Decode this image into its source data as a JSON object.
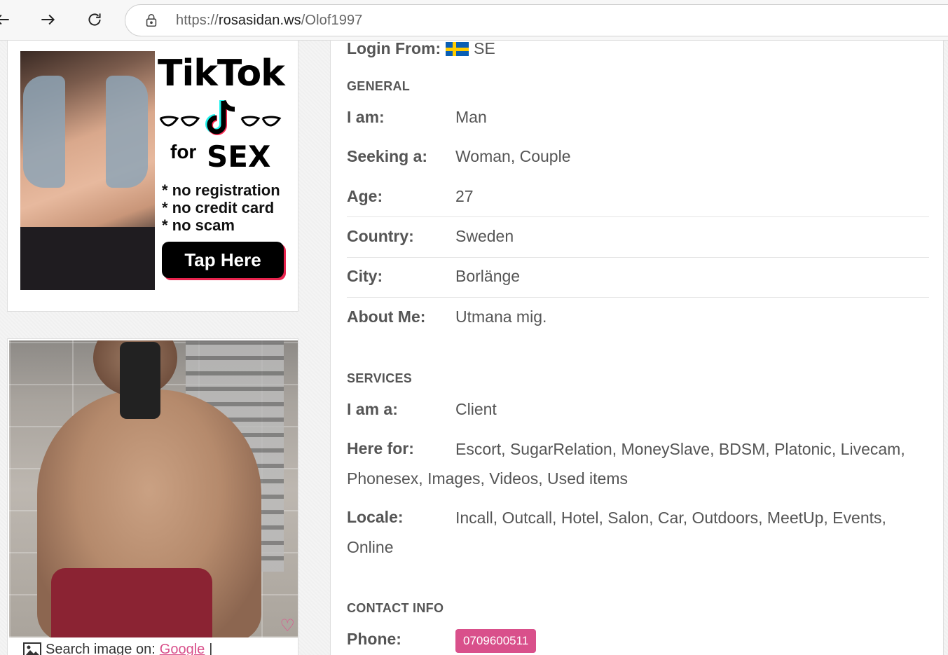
{
  "browser": {
    "url_scheme": "https://",
    "url_host": "rosasidan.ws",
    "url_path": "/Olof1997"
  },
  "ad": {
    "title": "TikTok",
    "for": "for",
    "sex": "SEX",
    "bullet1": "* no registration",
    "bullet2": "* no credit card",
    "bullet3": "* no scam",
    "cta": "Tap Here"
  },
  "photo": {
    "search_label": "Search image on:",
    "search_link": "Google",
    "separator": "|"
  },
  "profile": {
    "login_from_label": "Login From:",
    "login_from_country_code": "SE",
    "general": {
      "title": "GENERAL",
      "i_am_label": "I am:",
      "i_am": "Man",
      "seeking_label": "Seeking a:",
      "seeking": "Woman, Couple",
      "age_label": "Age:",
      "age": "27",
      "country_label": "Country:",
      "country": "Sweden",
      "city_label": "City:",
      "city": "Borlänge",
      "about_label": "About Me:",
      "about": "Utmana mig."
    },
    "services": {
      "title": "SERVICES",
      "i_am_a_label": "I am a:",
      "i_am_a": "Client",
      "here_for_label": "Here for:",
      "here_for": "Escort, SugarRelation, MoneySlave, BDSM, Platonic, Livecam, Phonesex, Images, Videos, Used items",
      "locale_label": "Locale:",
      "locale": "Incall, Outcall, Hotel, Salon, Car, Outdoors, MeetUp, Events, Online"
    },
    "contact": {
      "title": "CONTACT INFO",
      "phone_label": "Phone:",
      "phone": "0709600511"
    }
  },
  "colors": {
    "accent": "#d9508b",
    "flag_blue": "#0a5fb4",
    "flag_yellow": "#ffcc00"
  }
}
